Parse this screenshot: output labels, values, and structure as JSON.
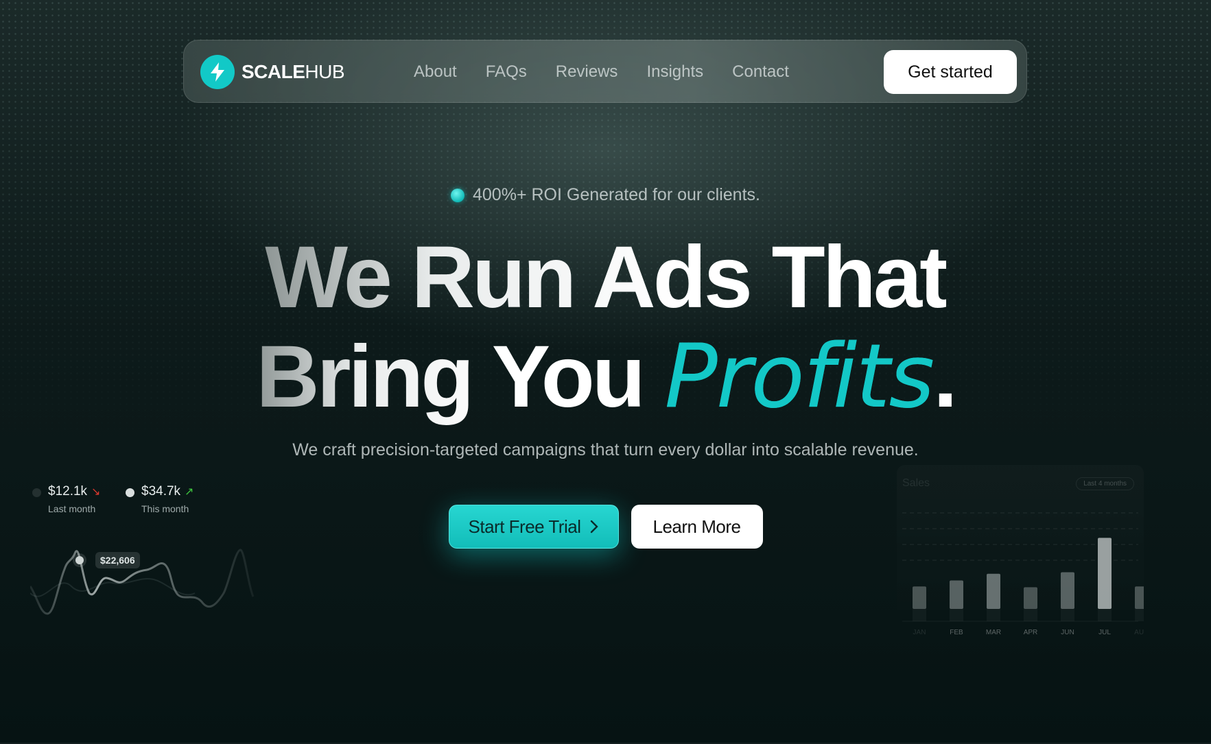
{
  "nav": {
    "brand_bold": "SCALE",
    "brand_light": "HUB",
    "logo_icon": "lightning-bolt-icon",
    "links": [
      "About",
      "FAQs",
      "Reviews",
      "Insights",
      "Contact"
    ],
    "cta_label": "Get started"
  },
  "hero": {
    "badge_text": "400%+ ROI Generated for our clients.",
    "headline_line1": "We Run Ads That",
    "headline_line2_a": "Bring You ",
    "headline_line2_b": "Profits",
    "headline_line2_c": ".",
    "subtitle": "We craft precision-targeted campaigns that turn every dollar into scalable revenue.",
    "primary_cta": "Start Free Trial",
    "primary_cta_icon": "chevron-right-icon",
    "secondary_cta": "Learn More"
  },
  "left_widget": {
    "last_value": "$12.1k",
    "last_label": "Last month",
    "last_trend_icon": "trend-down-icon",
    "this_value": "$34.7k",
    "this_label": "This month",
    "this_trend_icon": "trend-up-icon",
    "tooltip_value": "$22,606"
  },
  "chart_data": {
    "type": "bar",
    "title": "Sales",
    "range_label": "Last 4 months",
    "categories": [
      "JAN",
      "FEB",
      "MAR",
      "APR",
      "JUN",
      "JUL",
      "AUG"
    ],
    "values": [
      30,
      38,
      47,
      29,
      49,
      95,
      30
    ],
    "ylim": [
      0,
      110
    ],
    "grid": true
  },
  "colors": {
    "accent": "#12c9c7",
    "background_dark": "#061313",
    "trend_down": "#e0392f",
    "trend_up": "#3ec43e"
  }
}
